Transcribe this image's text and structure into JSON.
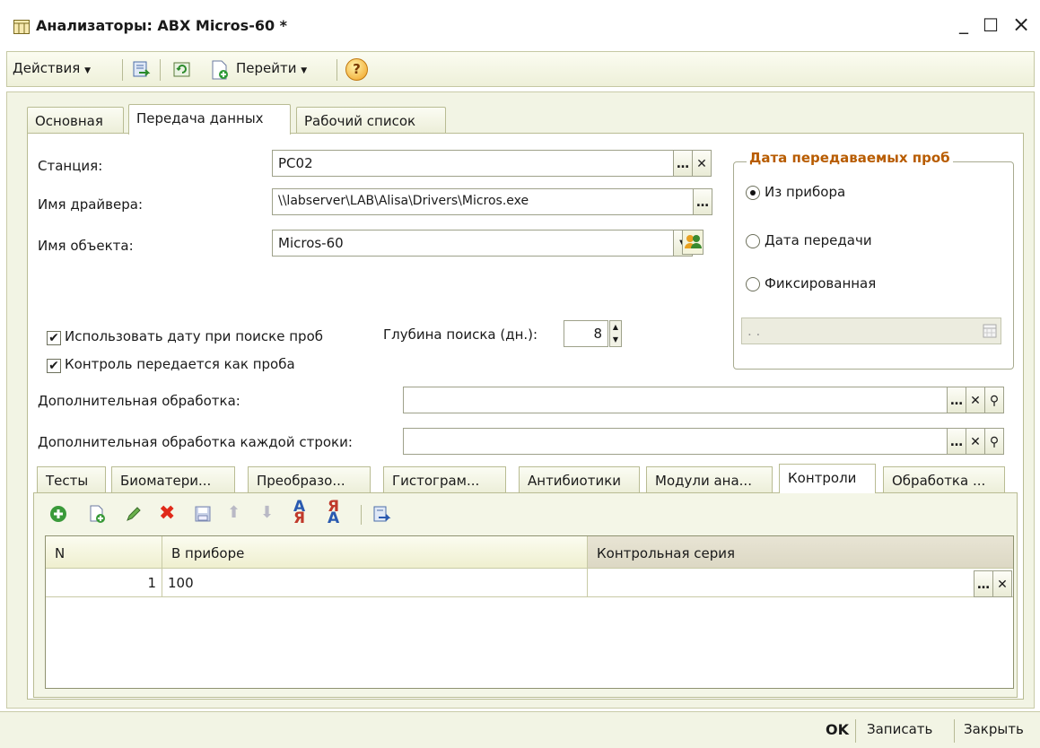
{
  "window": {
    "title": "Анализаторы: ABX Micros-60 *",
    "minimize": "_",
    "maximize": "☐",
    "close": "×"
  },
  "toolbar": {
    "actions_label": "Действия",
    "goto_label": "Перейти",
    "help_glyph": "?"
  },
  "tabs": [
    "Основная",
    "Передача данных",
    "Рабочий список"
  ],
  "form": {
    "station_label": "Станция:",
    "station_value": "PC02",
    "driver_label": "Имя драйвера:",
    "driver_value": "\\\\labserver\\LAB\\Alisa\\Drivers\\Micros.exe",
    "object_label": "Имя объекта:",
    "object_value": "Micros-60",
    "use_date_label": "Использовать дату при поиске проб",
    "use_date_checked": true,
    "control_label": "Контроль передается как проба",
    "control_checked": true,
    "depth_label": "Глубина поиска (дн.):",
    "depth_value": "8",
    "extra_processing_label": "Дополнительная обработка:",
    "extra_processing_value": "",
    "extra_row_processing_label": "Дополнительная обработка каждой строки:",
    "extra_row_processing_value": ""
  },
  "date_group": {
    "title": "Дата передаваемых проб",
    "options": [
      "Из прибора",
      "Дата передачи",
      "Фиксированная"
    ],
    "selected_index": 0,
    "date_value": ". ."
  },
  "inner_tabs": [
    "Тесты",
    "Биоматери...",
    "Преобразо...",
    "Гистограм...",
    "Антибиотики",
    "Модули ана...",
    "Контроли",
    "Обработка ..."
  ],
  "inner_tab_active": 6,
  "grid": {
    "columns": [
      "N",
      "В приборе",
      "Контрольная серия"
    ],
    "rows": [
      {
        "n": "1",
        "device": "100",
        "series": ""
      }
    ]
  },
  "buttons": {
    "ok": "OK",
    "save": "Записать",
    "close": "Закрыть"
  },
  "colors": {
    "accent_title": "#b85c00",
    "frame": "#f2f4e4"
  }
}
